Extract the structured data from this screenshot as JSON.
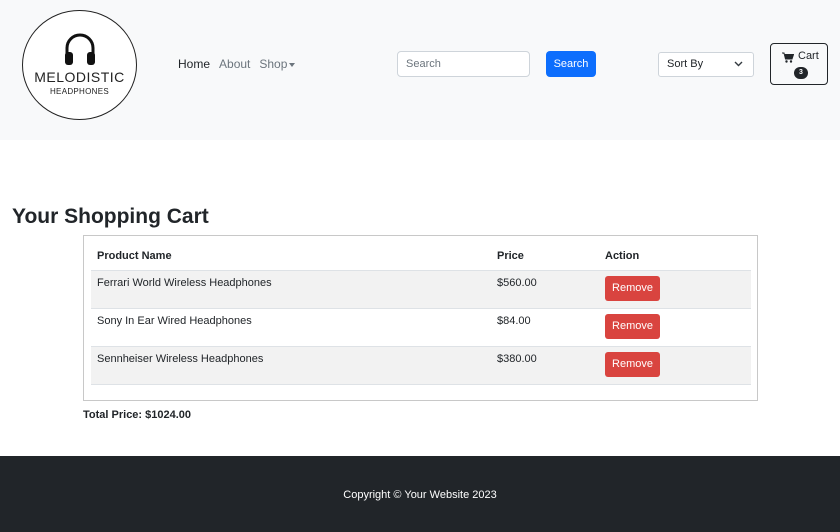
{
  "logo": {
    "brand": "MELODISTIC",
    "subtitle": "HEADPHONES"
  },
  "nav": {
    "items": [
      {
        "label": "Home"
      },
      {
        "label": "About"
      },
      {
        "label": "Shop"
      }
    ]
  },
  "search": {
    "placeholder": "Search",
    "button_label": "Search"
  },
  "sort": {
    "selected": "Sort By"
  },
  "cart": {
    "label": "Cart",
    "count": "3"
  },
  "main": {
    "title": "Your Shopping Cart",
    "columns": [
      "Product Name",
      "Price",
      "Action"
    ],
    "rows": [
      {
        "name": "Ferrari World Wireless Headphones",
        "price": "$560.00",
        "action": "Remove"
      },
      {
        "name": "Sony In Ear Wired Headphones",
        "price": "$84.00",
        "action": "Remove"
      },
      {
        "name": "Sennheiser Wireless Headphones",
        "price": "$380.00",
        "action": "Remove"
      }
    ],
    "total": "Total Price: $1024.00"
  },
  "footer": {
    "text": "Copyright © Your Website 2023"
  },
  "colors": {
    "primary": "#0d6efd",
    "danger": "#d9443f",
    "dark": "#212529",
    "header_bg": "#f8f9fa"
  }
}
